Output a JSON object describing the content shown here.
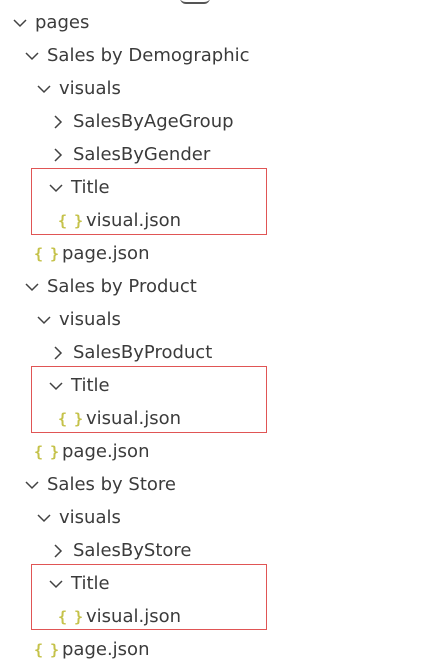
{
  "tree": {
    "root_label": "pages",
    "pages": [
      {
        "label": "Sales by Demographic",
        "visuals_label": "visuals",
        "visual_items": [
          "SalesByAgeGroup",
          "SalesByGender"
        ],
        "title_folder": "Title",
        "title_file": "visual.json",
        "page_file": "page.json"
      },
      {
        "label": "Sales by Product",
        "visuals_label": "visuals",
        "visual_items": [
          "SalesByProduct"
        ],
        "title_folder": "Title",
        "title_file": "visual.json",
        "page_file": "page.json"
      },
      {
        "label": "Sales by Store",
        "visuals_label": "visuals",
        "visual_items": [
          "SalesByStore"
        ],
        "title_folder": "Title",
        "title_file": "visual.json",
        "page_file": "page.json"
      }
    ]
  },
  "icons": {
    "expanded": "chevron-down-icon",
    "collapsed": "chevron-right-icon",
    "json_file": "json-file-icon",
    "json_glyph": "{ }"
  },
  "colors": {
    "text": "#3b3b3b",
    "json_icon": "#c5c24a",
    "highlight_border": "#e05555"
  }
}
